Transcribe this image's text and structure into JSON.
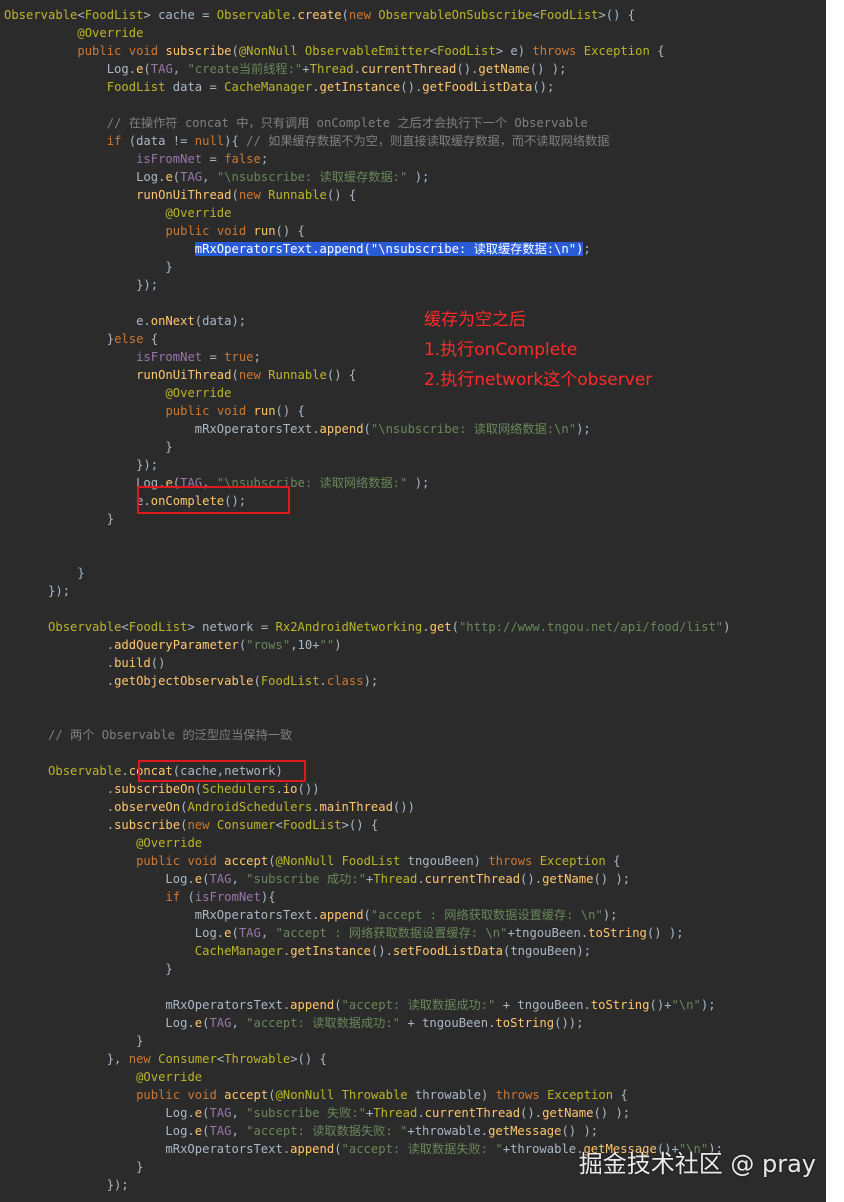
{
  "code_lines": [
    "Observable<FoodList> cache = Observable.create(new ObservableOnSubscribe<FoodList>() {",
    "          @Override",
    "          public void subscribe(@NonNull ObservableEmitter<FoodList> e) throws Exception {",
    "              Log.e(TAG, \"create当前线程:\"+Thread.currentThread().getName() );",
    "              FoodList data = CacheManager.getInstance().getFoodListData();",
    "",
    "              // 在操作符 concat 中，只有调用 onComplete 之后才会执行下一个 Observable",
    "              if (data != null){ // 如果缓存数据不为空，则直接读取缓存数据，而不读取网络数据",
    "                  isFromNet = false;",
    "                  Log.e(TAG, \"\\nsubscribe: 读取缓存数据:\" );",
    "                  runOnUiThread(new Runnable() {",
    "                      @Override",
    "                      public void run() {",
    "                          mRxOperatorsText.append(\"\\nsubscribe: 读取缓存数据:\\n\");",
    "                      }",
    "                  });",
    "",
    "                  e.onNext(data);",
    "              }else {",
    "                  isFromNet = true;",
    "                  runOnUiThread(new Runnable() {",
    "                      @Override",
    "                      public void run() {",
    "                          mRxOperatorsText.append(\"\\nsubscribe: 读取网络数据:\\n\");",
    "                      }",
    "                  });",
    "                  Log.e(TAG, \"\\nsubscribe: 读取网络数据:\" );",
    "                  e.onComplete();",
    "              }",
    "",
    "",
    "          }",
    "      });",
    "",
    "      Observable<FoodList> network = Rx2AndroidNetworking.get(\"http://www.tngou.net/api/food/list\")",
    "              .addQueryParameter(\"rows\",10+\"\")",
    "              .build()",
    "              .getObjectObservable(FoodList.class);",
    "",
    "",
    "      // 两个 Observable 的泛型应当保持一致",
    "",
    "      Observable.concat(cache,network)",
    "              .subscribeOn(Schedulers.io())",
    "              .observeOn(AndroidSchedulers.mainThread())",
    "              .subscribe(new Consumer<FoodList>() {",
    "                  @Override",
    "                  public void accept(@NonNull FoodList tngouBeen) throws Exception {",
    "                      Log.e(TAG, \"subscribe 成功:\"+Thread.currentThread().getName() );",
    "                      if (isFromNet){",
    "                          mRxOperatorsText.append(\"accept : 网络获取数据设置缓存: \\n\");",
    "                          Log.e(TAG, \"accept : 网络获取数据设置缓存: \\n\"+tngouBeen.toString() );",
    "                          CacheManager.getInstance().setFoodListData(tngouBeen);",
    "                      }",
    "",
    "                      mRxOperatorsText.append(\"accept: 读取数据成功:\" + tngouBeen.toString()+\"\\n\");",
    "                      Log.e(TAG, \"accept: 读取数据成功:\" + tngouBeen.toString());",
    "                  }",
    "              }, new Consumer<Throwable>() {",
    "                  @Override",
    "                  public void accept(@NonNull Throwable throwable) throws Exception {",
    "                      Log.e(TAG, \"subscribe 失败:\"+Thread.currentThread().getName() );",
    "                      Log.e(TAG, \"accept: 读取数据失败: \"+throwable.getMessage() );",
    "                      mRxOperatorsText.append(\"accept: 读取数据失败: \"+throwable.getMessage()+\"\\n\");",
    "                  }",
    "              });"
  ],
  "annotations": [
    "缓存为空之后",
    "1.执行onComplete",
    "2.执行network这个observer"
  ],
  "watermark": "掘金技术社区 @ pray",
  "colors": {
    "background": "#2b2b2b",
    "keyword": "#cc7832",
    "string": "#6a8759",
    "method": "#ffc66d",
    "type": "#bbb529",
    "comment": "#808080",
    "annotation_red": "#ff2a2a",
    "box_red": "#e0181f"
  }
}
